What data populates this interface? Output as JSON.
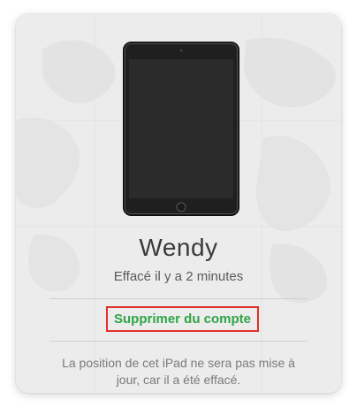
{
  "device": {
    "name": "Wendy",
    "status": "Effacé il y a 2 minutes",
    "icon": "ipad-icon"
  },
  "actions": {
    "remove_label": "Supprimer du compte"
  },
  "message": {
    "line1": "La position de cet iPad ne sera pas mise à",
    "line2": "jour, car il a été effacé."
  },
  "colors": {
    "card_background": "#ececec",
    "action_text": "#2fa545",
    "highlight_border": "#e0312b",
    "screen": "#2b2b2b"
  }
}
